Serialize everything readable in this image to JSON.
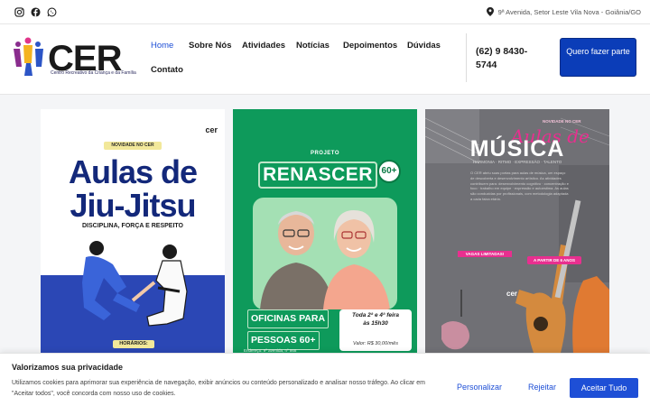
{
  "topbar": {
    "social_icons": [
      "instagram-icon",
      "facebook-icon",
      "whatsapp-icon"
    ],
    "address": "9ª Avenida, Setor Leste Vila Nova - Goiânia/GO"
  },
  "header": {
    "logo_text": "CER",
    "logo_subtitle": "Centro Recreativo da Criança e da Família",
    "nav": [
      "Home",
      "Sobre Nós",
      "Atividades",
      "Notícias",
      "Depoimentos",
      "Dúvidas",
      "Contato"
    ],
    "active_nav": "Home",
    "phone": "(62) 9 8430-5744",
    "cta": "Quero fazer parte"
  },
  "cards": {
    "jiujitsu": {
      "logo": "cer",
      "badge": "NOVIDADE NO CER",
      "title_line1": "Aulas de",
      "title_line2": "Jiu-Jitsu",
      "subtitle": "DISCIPLINA, FORÇA E RESPEITO",
      "horarios": "HORÁRIOS:"
    },
    "renascer": {
      "kicker": "PROJETO",
      "title": "RENASCER",
      "badge": "60+",
      "line1": "OFICINAS PARA",
      "line2": "PESSOAS 60+",
      "days": "Toda 2ª e 4ª feira",
      "hour": "às 15h30",
      "price": "Valor: R$ 30,00/mês",
      "address": "Endereço: 9ª avenida, nº 868"
    },
    "musica": {
      "badge": "NOVIDADE NO CER",
      "script": "Aulas de",
      "title": "MÚSICA",
      "tagline": "HARMONIA · RITMO · EXPRESSÃO · TALENTO",
      "text": "O CER abriu suas portas para aulas de música, um espaço de descoberta e desenvolvimento artístico. As atividades contribuem para: desenvolvimento cognitivo · concentração e foco · trabalho em equipe · expressão e autoestima. As aulas são conduzidas por profissionais, com metodologia adaptada a cada faixa etária.",
      "vagas": "VAGAS LIMITADAS!",
      "idade": "A PARTIR DE 6 ANOS",
      "logo": "cer"
    }
  },
  "cookie": {
    "title": "Valorizamos sua privacidade",
    "text": "Utilizamos cookies para aprimorar sua experiência de navegação, exibir anúncios ou conteúdo personalizado e analisar nosso tráfego. Ao clicar em \"Aceitar todos\", você concorda com nosso uso de cookies.",
    "customize": "Personalizar",
    "reject": "Rejeitar",
    "accept": "Aceitar Tudo"
  },
  "colors": {
    "primary": "#1e4fd6",
    "cta": "#0b3db8",
    "green": "#0e9a5b",
    "navy": "#13287a",
    "pink": "#e82f8f"
  }
}
